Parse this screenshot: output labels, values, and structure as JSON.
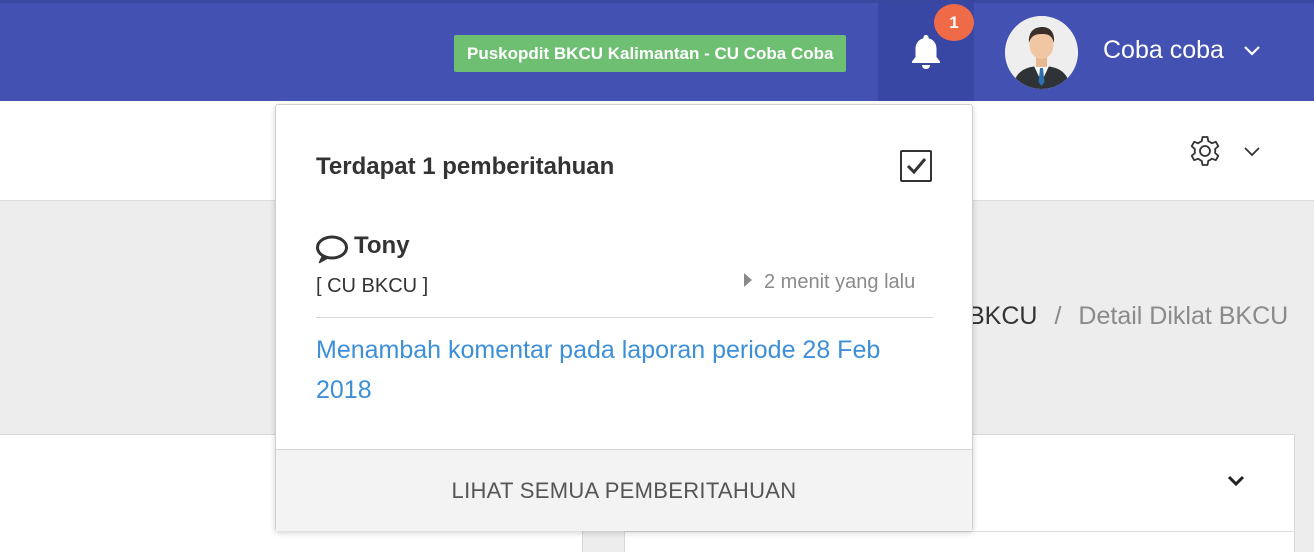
{
  "header": {
    "org_badge": "Puskopdit BKCU Kalimantan - CU Coba Coba",
    "notification_count": "1",
    "user_name": "Coba coba",
    "icons": {
      "bell": "bell-icon",
      "user_menu": "chevron-down-icon",
      "settings": "gear-icon"
    }
  },
  "breadcrumb": {
    "items": [
      "BKCU",
      "Detail Diklat BKCU"
    ],
    "separator": "/"
  },
  "notifications": {
    "title": "Terdapat 1 pemberitahuan",
    "mark_all_read_icon": "check-square-icon",
    "items": [
      {
        "icon": "comment-icon",
        "sender": "Tony",
        "org": "[ CU BKCU ]",
        "time": "2 menit yang lalu",
        "message": "Menambah komentar pada laporan periode 28 Feb 2018"
      }
    ],
    "footer_label": "LIHAT SEMUA PEMBERITAHUAN"
  },
  "colors": {
    "header_bg": "#4352b2",
    "badge_green": "#6fbf73",
    "notification_badge": "#ef6b48",
    "link_blue": "#3d8fd8"
  }
}
